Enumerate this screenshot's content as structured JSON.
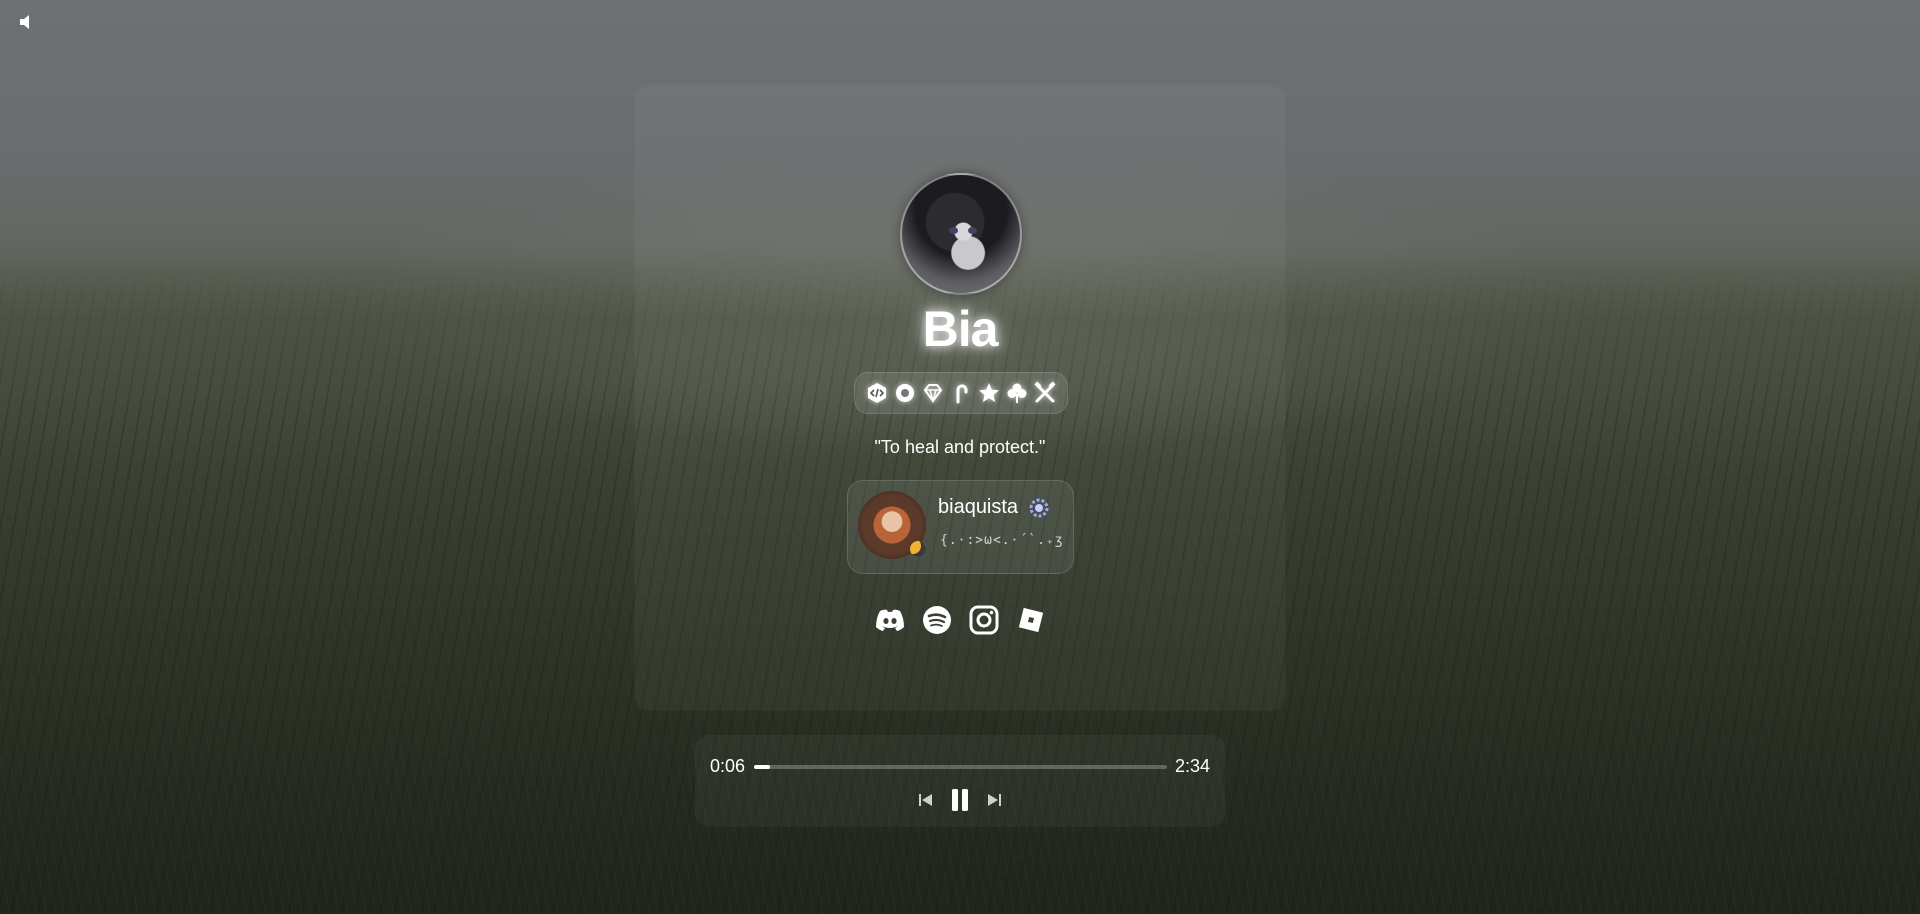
{
  "profile": {
    "display_name": "Bia",
    "bio": "\"To heal and protect.\"",
    "badges": [
      "code-badge",
      "flower-badge",
      "diamond-badge",
      "candy-cane-badge",
      "star-badge",
      "clover-badge",
      "tools-badge"
    ]
  },
  "discord": {
    "username": "biaquista",
    "custom_status": "{.·:>ω<.·´`.₊ʒ",
    "status_color": "#f0b232",
    "badge_icon": "nitro-badge-icon"
  },
  "socials": [
    "discord-icon",
    "spotify-icon",
    "instagram-icon",
    "roblox-icon"
  ],
  "player": {
    "current_time": "0:06",
    "total_time": "2:34",
    "progress": 0.039
  },
  "audio": {
    "mute_icon": "speaker-icon"
  }
}
